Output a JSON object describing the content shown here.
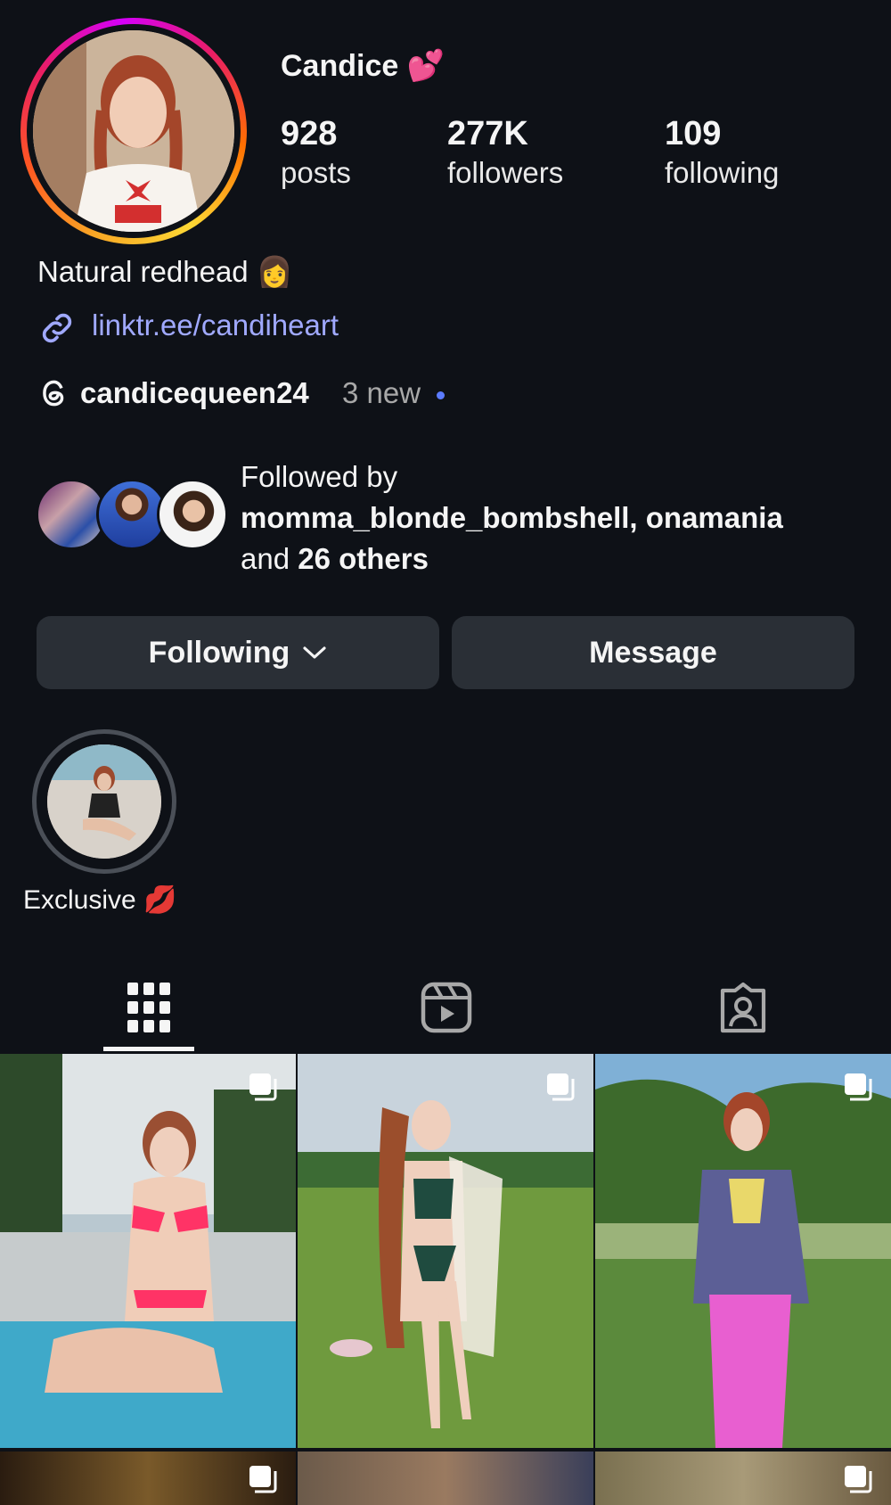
{
  "profile": {
    "display_name": "Candice 💕",
    "stats": [
      {
        "value": "928",
        "label": "posts"
      },
      {
        "value": "277K",
        "label": "followers"
      },
      {
        "value": "109",
        "label": "following"
      }
    ],
    "bio": "Natural redhead 👩",
    "link": "linktr.ee/candiheart",
    "threads": {
      "handle": "candicequeen24",
      "new_label": "3 new"
    },
    "followed_by": {
      "prefix": "Followed by",
      "names": "momma_blonde_bombshell, onamania",
      "and": "and",
      "others": "26 others"
    }
  },
  "actions": {
    "following_label": "Following",
    "message_label": "Message"
  },
  "highlights": [
    {
      "label": "Exclusive 💋"
    }
  ],
  "tabs": [
    {
      "icon": "grid-icon"
    },
    {
      "icon": "reels-icon"
    },
    {
      "icon": "tagged-icon"
    }
  ],
  "colors": {
    "background": "#0e1117",
    "button": "#2a2f36",
    "link": "#a0a9ff",
    "accent_dot": "#5b7bff"
  }
}
